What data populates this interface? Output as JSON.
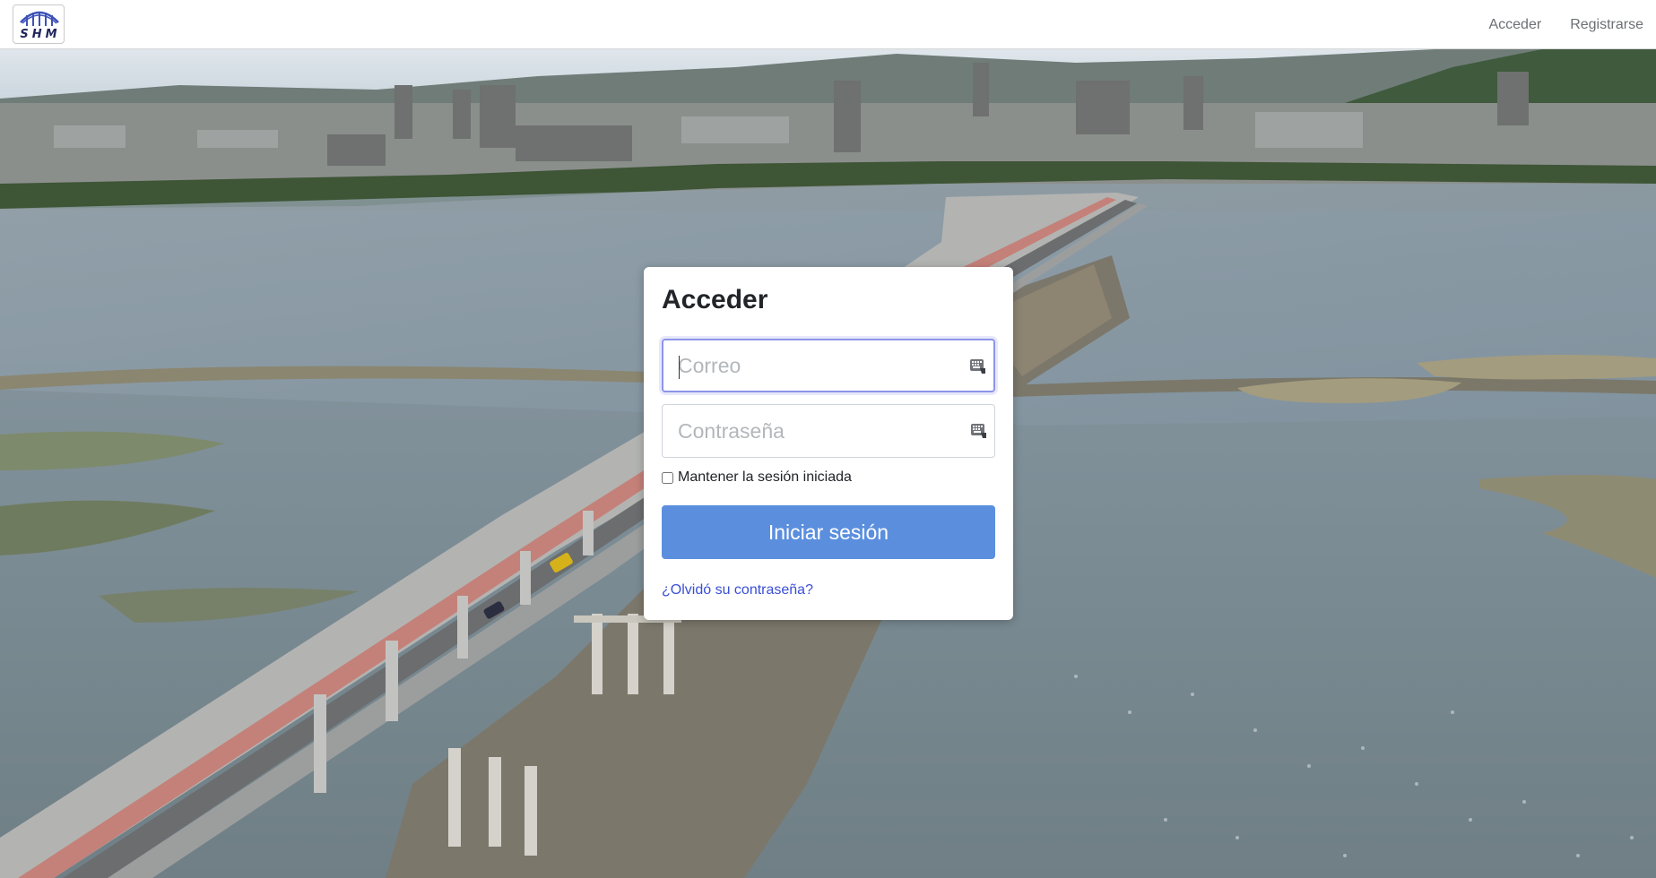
{
  "brand": {
    "logo_text": "SHM"
  },
  "nav": {
    "links": [
      {
        "label": "Acceder"
      },
      {
        "label": "Registrarse"
      }
    ]
  },
  "login": {
    "title": "Acceder",
    "email": {
      "placeholder": "Correo",
      "value": ""
    },
    "password": {
      "placeholder": "Contraseña",
      "value": ""
    },
    "remember_label": "Mantener la sesión iniciada",
    "remember_checked": false,
    "submit_label": "Iniciar sesión",
    "forgot_label": "¿Olvidó su contraseña?"
  },
  "icons": {
    "logo": "bridge-logo-icon",
    "field_autofill": "keyboard-icon"
  },
  "colors": {
    "primary_button": "#5b8fde",
    "link": "#3a4fd6",
    "focus_border": "#8c95e8"
  }
}
